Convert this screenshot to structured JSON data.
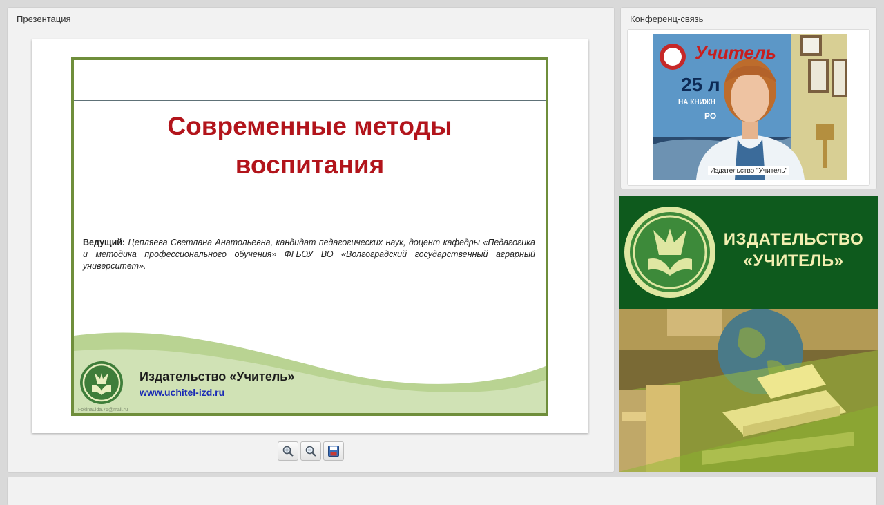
{
  "presentation_panel": {
    "title": "Презентация"
  },
  "slide": {
    "title_line1": "Современные методы",
    "title_line2": "воспитания",
    "presenter_label": "Ведущий:",
    "presenter_text": "Цепляева Светлана Анатольевна, кандидат педагогических наук, доцент кафедры «Педагогика и методика профессионального обучения» ФГБОУ ВО «Волгоградский государственный аграрный университет».",
    "publisher": "Издательство «Учитель»",
    "website": "www.uchitel-izd.ru",
    "watermark": "FokinaLida.75@mail.ru"
  },
  "toolbar": {
    "zoom_in_icon": "zoom-in-icon",
    "zoom_out_icon": "zoom-out-icon",
    "save_icon": "save-icon"
  },
  "conference_panel": {
    "title": "Конференц-связь",
    "video_caption": "Издательство \"Учитель\"",
    "poster_brand": "Учитель",
    "poster_number": "25 л",
    "poster_line": "НА КНИЖН",
    "poster_tail": "РО"
  },
  "banner": {
    "name_line1": "ИЗДАТЕЛЬСТВО",
    "name_line2": "«УЧИТЕЛЬ»"
  },
  "colors": {
    "slide_border": "#6f8e3b",
    "slide_title": "#b2141b",
    "banner_green": "#0e5a1d",
    "banner_text": "#f2efb1"
  }
}
